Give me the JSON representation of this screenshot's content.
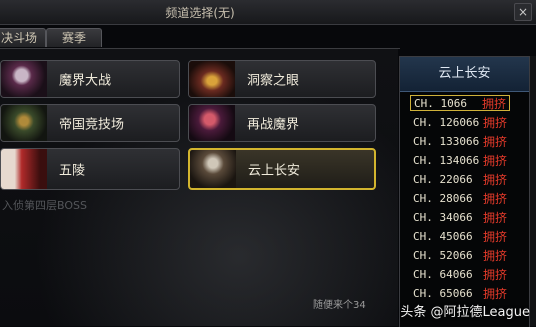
{
  "window": {
    "title": "频道选择(无)",
    "close_symbol": "×"
  },
  "tabs": [
    {
      "label": "决斗场"
    },
    {
      "label": "赛季"
    }
  ],
  "dungeons": [
    {
      "label": "魔界大战"
    },
    {
      "label": "洞察之眼"
    },
    {
      "label": "帝国竞技场"
    },
    {
      "label": "再战魔界"
    },
    {
      "label": "五陵"
    },
    {
      "label": "云上长安",
      "selected": true
    }
  ],
  "background_text": {
    "left_text": "入侦第四层BOSS",
    "chat_text": "随便来个34"
  },
  "channel_panel": {
    "header": "云上长安",
    "channels": [
      {
        "name": "CH. 1066",
        "status": "拥挤",
        "selected": true
      },
      {
        "name": "CH. 126066",
        "status": "拥挤"
      },
      {
        "name": "CH. 133066",
        "status": "拥挤"
      },
      {
        "name": "CH. 134066",
        "status": "拥挤"
      },
      {
        "name": "CH. 22066",
        "status": "拥挤"
      },
      {
        "name": "CH. 28066",
        "status": "拥挤"
      },
      {
        "name": "CH. 34066",
        "status": "拥挤"
      },
      {
        "name": "CH. 45066",
        "status": "拥挤"
      },
      {
        "name": "CH. 52066",
        "status": "拥挤"
      },
      {
        "name": "CH. 64066",
        "status": "拥挤"
      },
      {
        "name": "CH. 65066",
        "status": "拥挤"
      }
    ]
  },
  "watermark": "头条 @阿拉德League",
  "colors": {
    "selected_border": "#d3b52e",
    "status_crowded": "#e33a2a",
    "panel_header": "#1b2d42"
  }
}
